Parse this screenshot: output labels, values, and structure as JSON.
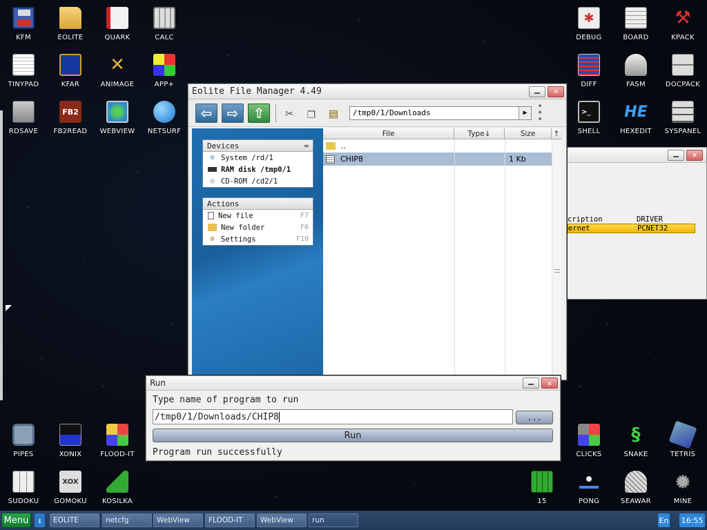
{
  "desktop": {
    "icons_top_left": [
      {
        "label": "KFM",
        "icon": "floppy-icon"
      },
      {
        "label": "EOLITE",
        "icon": "folder-icon"
      },
      {
        "label": "QUARK",
        "icon": "book-icon"
      },
      {
        "label": "CALC",
        "icon": "calculator-icon"
      },
      {
        "label": "TINYPAD",
        "icon": "notepad-icon"
      },
      {
        "label": "KFAR",
        "icon": "dual-panel-icon"
      },
      {
        "label": "ANIMAGE",
        "icon": "paint-tools-icon"
      },
      {
        "label": "APP+",
        "icon": "cube-icon"
      },
      {
        "label": "RDSAVE",
        "icon": "disk-save-icon"
      },
      {
        "label": "FB2READ",
        "icon": "fb2-book-icon"
      },
      {
        "label": "WEBVIEW",
        "icon": "globe-map-icon"
      },
      {
        "label": "NETSURF",
        "icon": "globe-icon"
      }
    ],
    "icons_top_right": [
      {
        "label": "DEBUG",
        "icon": "bug-icon"
      },
      {
        "label": "BOARD",
        "icon": "board-icon"
      },
      {
        "label": "KPACK",
        "icon": "hammer-icon"
      },
      {
        "label": "DIFF",
        "icon": "diff-icon"
      },
      {
        "label": "FASM",
        "icon": "fasm-icon"
      },
      {
        "label": "DOCPACK",
        "icon": "cabinet-icon"
      },
      {
        "label": "SHELL",
        "icon": "terminal-icon"
      },
      {
        "label": "HEXEDIT",
        "icon": "hex-icon"
      },
      {
        "label": "SYSPANEL",
        "icon": "sliders-icon"
      }
    ],
    "icons_bottom_left": [
      {
        "label": "PIPES",
        "icon": "pipes-icon"
      },
      {
        "label": "XONIX",
        "icon": "xonix-icon"
      },
      {
        "label": "FLOOD-IT",
        "icon": "flood-grid-icon"
      },
      {
        "label": "SUDOKU",
        "icon": "sudoku-icon"
      },
      {
        "label": "GOMOKU",
        "icon": "gomoku-icon"
      },
      {
        "label": "KOSILKA",
        "icon": "lawnmower-icon"
      }
    ],
    "icons_bottom_right": [
      {
        "label": "CLICKS",
        "icon": "blocks-icon"
      },
      {
        "label": "SNAKE",
        "icon": "snake-icon"
      },
      {
        "label": "TETRIS",
        "icon": "tetris-icon"
      },
      {
        "label": "15",
        "icon": "fifteen-grid-icon"
      },
      {
        "label": "PONG",
        "icon": "pong-icon"
      },
      {
        "label": "SEAWAR",
        "icon": "ship-icon"
      },
      {
        "label": "MINE",
        "icon": "mine-icon"
      }
    ]
  },
  "file_manager": {
    "title": "Eolite File Manager 4.49",
    "path": "/tmp0/1/Downloads",
    "devices_header": "Devices",
    "devices_toggle": "=",
    "devices": [
      {
        "label": "System /rd/1",
        "icon": "system-disk-icon"
      },
      {
        "label": "RAM disk /tmp0/1",
        "icon": "ram-disk-icon",
        "bold": true
      },
      {
        "label": "CD-ROM /cd2/1",
        "icon": "cdrom-icon"
      }
    ],
    "actions_header": "Actions",
    "actions": [
      {
        "label": "New file",
        "key": "F7"
      },
      {
        "label": "New folder",
        "key": "F6"
      },
      {
        "label": "Settings",
        "key": "F10"
      }
    ],
    "columns": {
      "file": "File",
      "type": "Type↓",
      "size": "Size",
      "sort": "↑"
    },
    "rows": [
      {
        "name": "..",
        "size": ""
      },
      {
        "name": "CHIP8",
        "size": "1 Kb"
      }
    ]
  },
  "netcfg_window": {
    "col_description": "cription",
    "col_driver": "DRIVER",
    "row_description": "ernet",
    "row_driver": "PCNET32"
  },
  "run_dialog": {
    "title": "Run",
    "prompt": "Type name of program to run",
    "value": "/tmp0/1/Downloads/CHIP8",
    "browse_label": "...",
    "run_label": "Run",
    "status": "Program run successfully"
  },
  "taskbar": {
    "menu_label": "Menu",
    "swap_label": "↕",
    "tasks": [
      "EOLITE",
      "netcfg",
      "WebView",
      "FLOOD-IT",
      "WebView",
      "run"
    ],
    "lang": "En",
    "clock": "16:55"
  },
  "colors": {
    "selection": "#a8bcd4",
    "highlight_row": "#f7c800",
    "taskbar": "#2d4769",
    "menu_green": "#1a9a3c"
  }
}
